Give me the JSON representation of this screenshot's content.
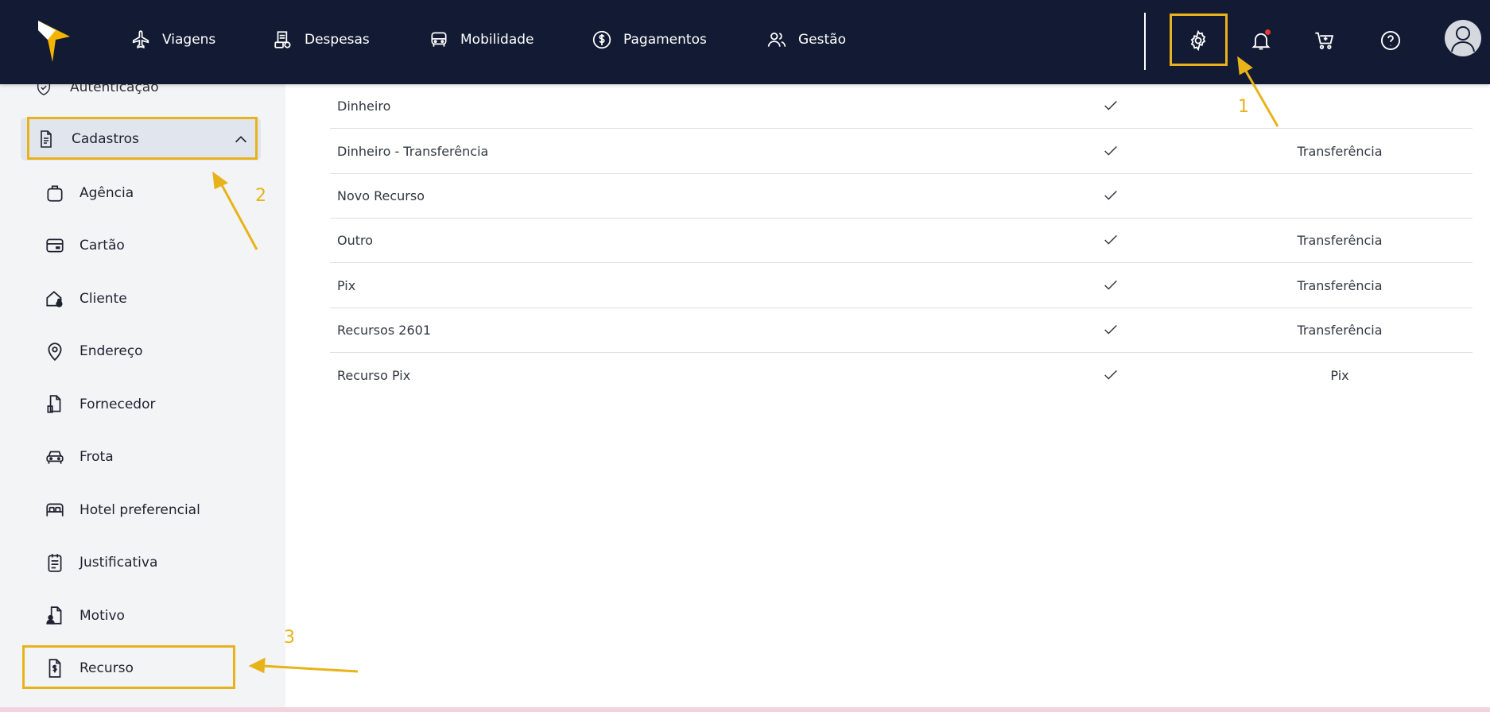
{
  "nav": {
    "items": [
      {
        "label": "Viagens",
        "icon": "plane-icon"
      },
      {
        "label": "Despesas",
        "icon": "receipt-icon"
      },
      {
        "label": "Mobilidade",
        "icon": "car-icon"
      },
      {
        "label": "Pagamentos",
        "icon": "dollar-circle-icon"
      },
      {
        "label": "Gestão",
        "icon": "users-icon"
      }
    ],
    "right_icons": [
      "gear-icon",
      "bell-icon",
      "cart-icon",
      "help-icon",
      "user-avatar-icon"
    ]
  },
  "sidebar": {
    "cut_item": "Autenticação",
    "group": {
      "label": "Cadastros",
      "expanded": true
    },
    "items": [
      {
        "label": "Agência",
        "icon": "briefcase-icon"
      },
      {
        "label": "Cartão",
        "icon": "credit-card-icon"
      },
      {
        "label": "Cliente",
        "icon": "home-user-icon"
      },
      {
        "label": "Endereço",
        "icon": "map-pin-icon"
      },
      {
        "label": "Fornecedor",
        "icon": "file-icon"
      },
      {
        "label": "Frota",
        "icon": "car-icon"
      },
      {
        "label": "Hotel preferencial",
        "icon": "bed-icon"
      },
      {
        "label": "Justificativa",
        "icon": "clipboard-icon"
      },
      {
        "label": "Motivo",
        "icon": "file-user-icon"
      },
      {
        "label": "Recurso",
        "icon": "file-dollar-icon"
      }
    ]
  },
  "table": {
    "rows": [
      {
        "name": "Dinheiro",
        "active": true,
        "type": ""
      },
      {
        "name": "Dinheiro - Transferência",
        "active": true,
        "type": "Transferência"
      },
      {
        "name": "Novo Recurso",
        "active": true,
        "type": ""
      },
      {
        "name": "Outro",
        "active": true,
        "type": "Transferência"
      },
      {
        "name": "Pix",
        "active": true,
        "type": "Transferência"
      },
      {
        "name": "Recursos 2601",
        "active": true,
        "type": "Transferência"
      },
      {
        "name": "Recurso Pix",
        "active": true,
        "type": "Pix"
      }
    ]
  },
  "annotations": {
    "step1": "1",
    "step2": "2",
    "step3": "3",
    "color": "#e8b31a"
  },
  "colors": {
    "topbar": "#121b33",
    "sidebar": "#f3f4f6",
    "group_bg": "#e1e6ee",
    "logo": "#f5b400"
  }
}
